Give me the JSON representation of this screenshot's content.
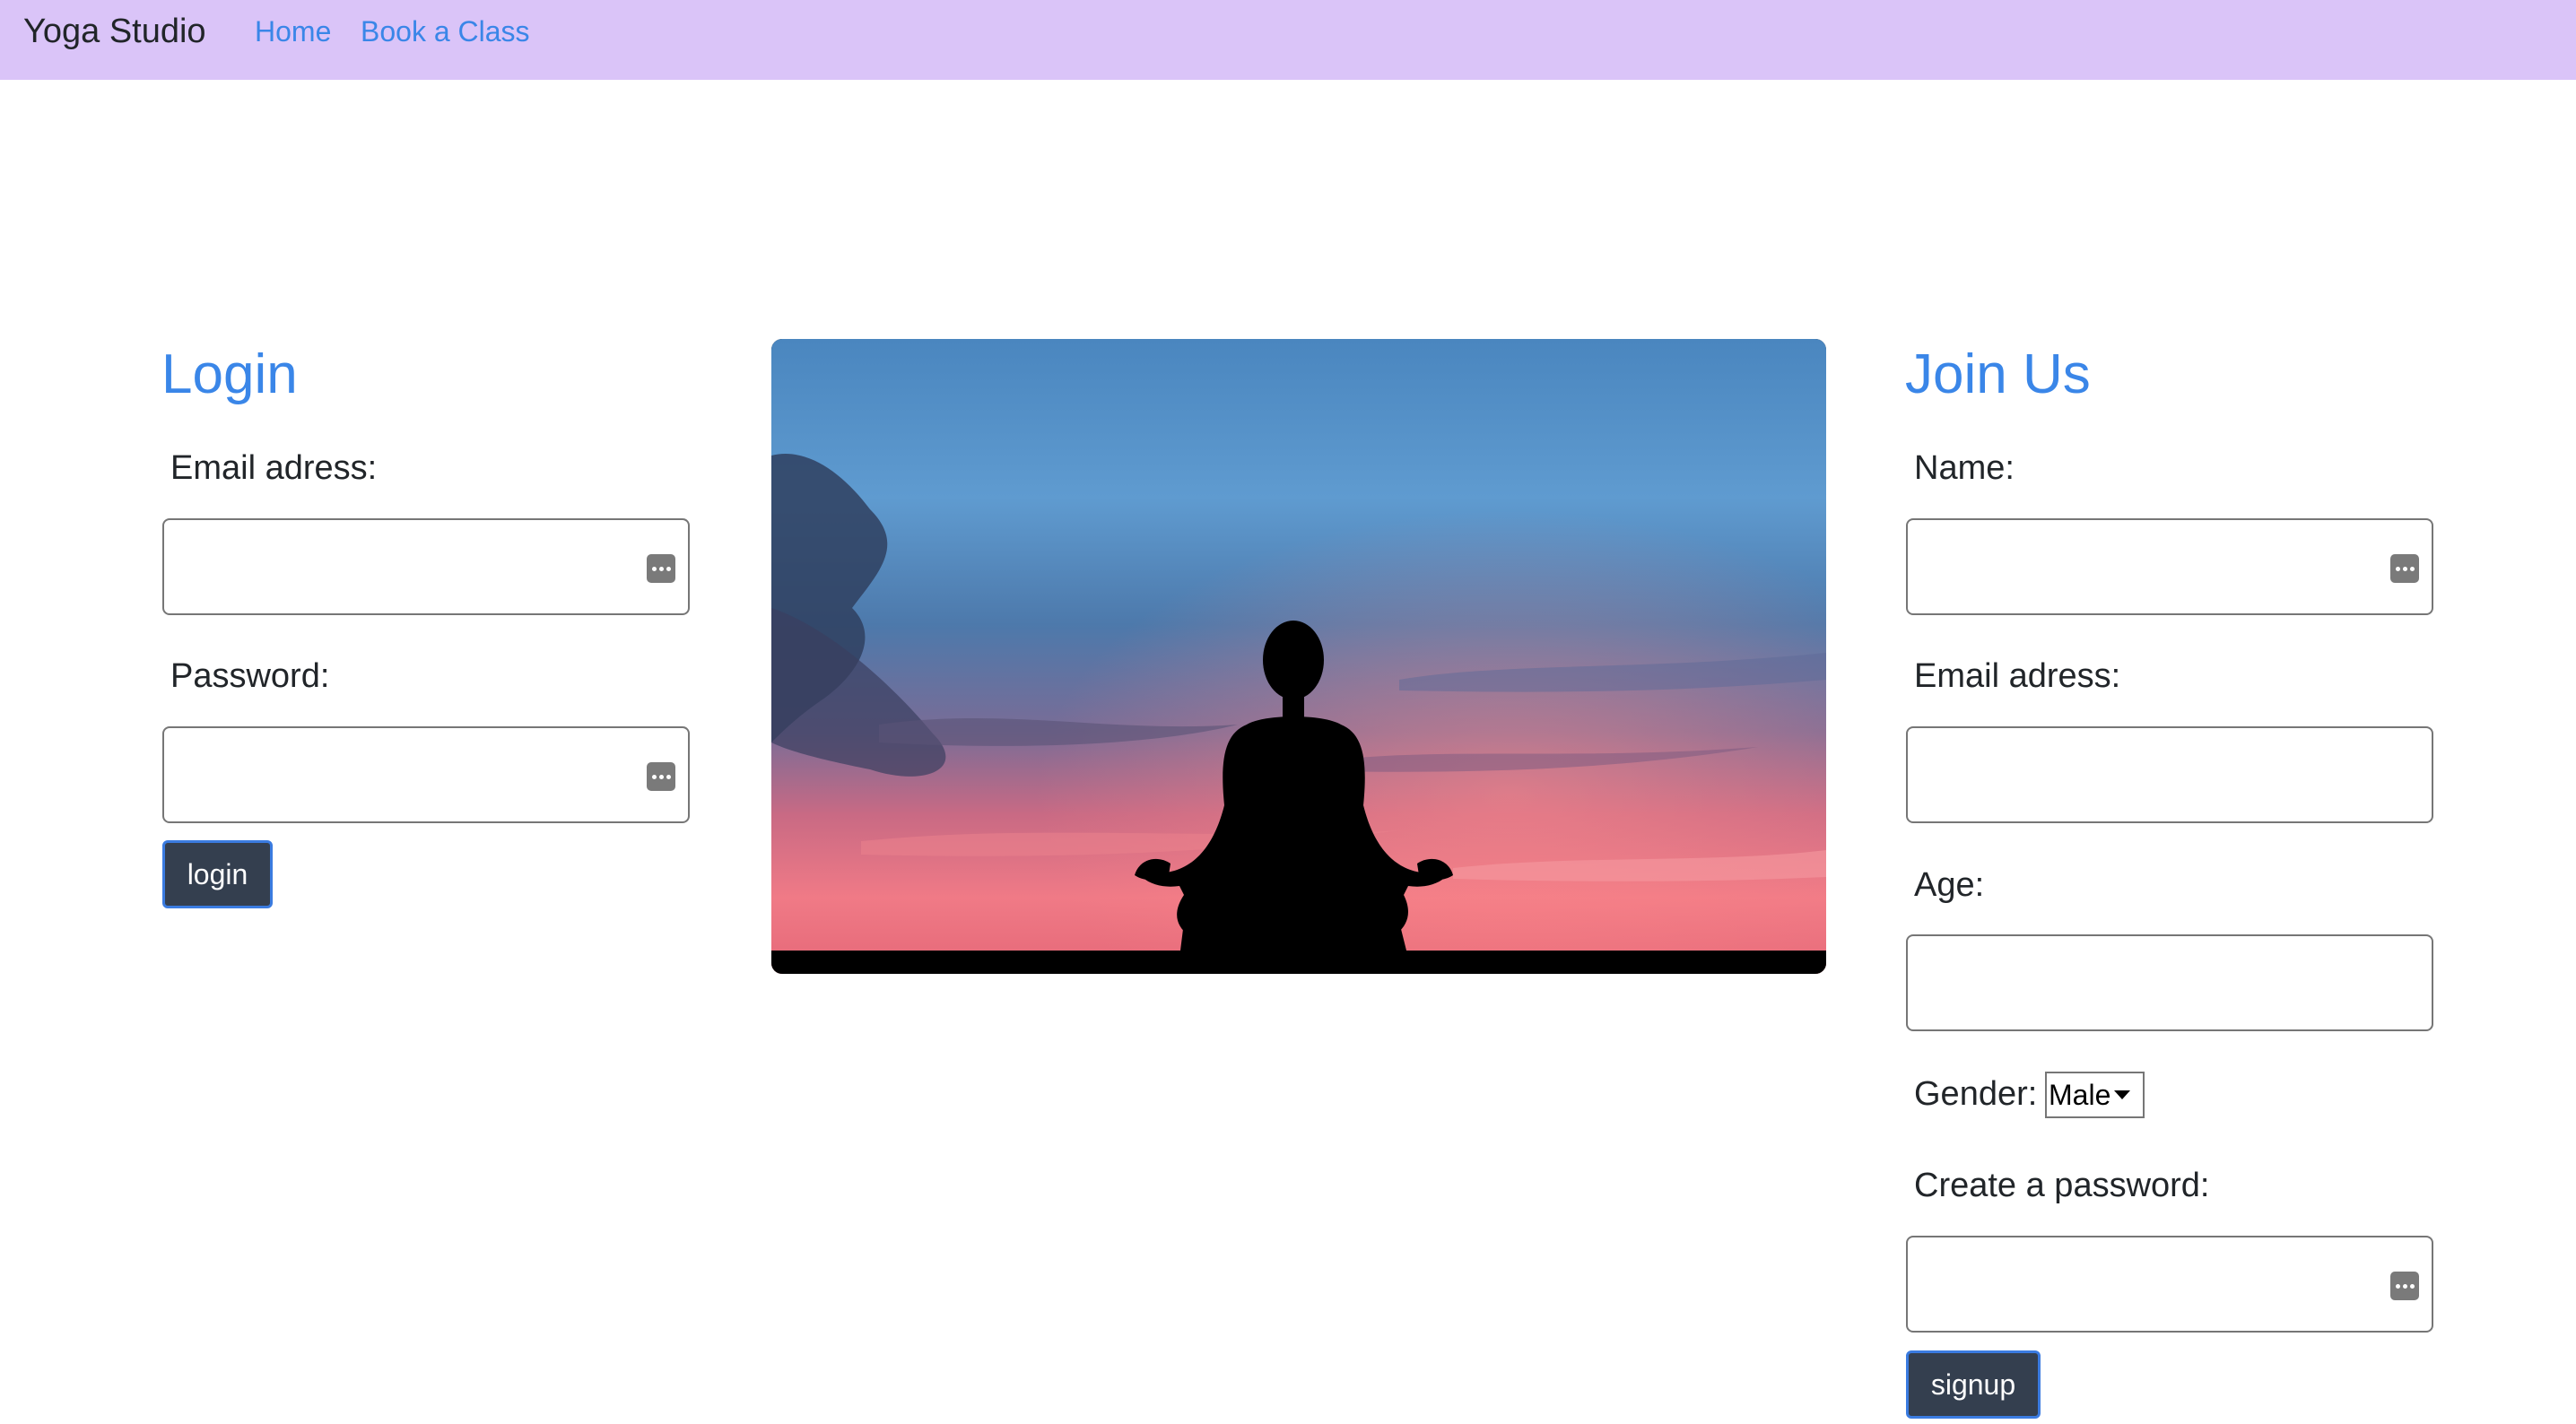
{
  "nav": {
    "brand": "Yoga Studio",
    "links": [
      "Home",
      "Book a Class"
    ]
  },
  "login": {
    "title": "Login",
    "email_label": "Email adress:",
    "password_label": "Password:",
    "button": "login"
  },
  "signup": {
    "title": "Join Us",
    "name_label": "Name:",
    "email_label": "Email adress:",
    "age_label": "Age:",
    "gender_label": "Gender:",
    "gender_selected": "Male",
    "password_label": "Create a password:",
    "button": "signup"
  },
  "hero": {
    "icon": "meditation-silhouette-image"
  },
  "colors": {
    "navbar": "#dac4f8",
    "accent": "#3a86e8",
    "button": "#343f4f"
  }
}
